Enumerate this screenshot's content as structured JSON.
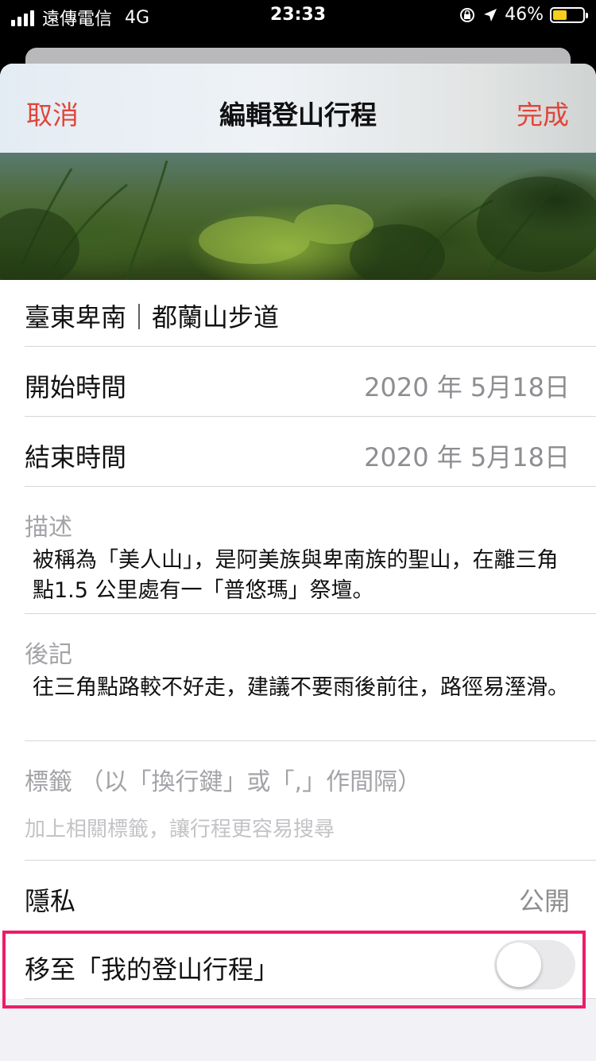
{
  "status_bar": {
    "carrier": "遠傳電信",
    "network": "4G",
    "time": "23:33",
    "battery": "46%",
    "battery_level": 0.46,
    "battery_color": "#f5cf1a"
  },
  "navbar": {
    "cancel_label": "取消",
    "title": "編輯登山行程",
    "done_label": "完成",
    "accent_color": "#e0453a"
  },
  "trip": {
    "name": "臺東卑南｜都蘭山步道",
    "start_label": "開始時間",
    "start_value": "2020 年 5月18日",
    "end_label": "結束時間",
    "end_value": "2020 年 5月18日",
    "description_label": "描述",
    "description_text": "被稱為「美人山」，是阿美族與卑南族的聖山，在離三角點1.5 公里處有一「普悠瑪」祭壇。",
    "notes_label": "後記",
    "notes_text": "往三角點路較不好走，建議不要雨後前往，路徑易溼滑。",
    "tags_label": "標籤 （以「換行鍵」或「,」作間隔）",
    "tags_placeholder": "加上相關標籤，讓行程更容易搜尋",
    "privacy_label": "隱私",
    "privacy_value": "公開",
    "move_label": "移至「我的登山行程」",
    "move_toggle_on": false
  },
  "highlight_color": "#ee1c68"
}
